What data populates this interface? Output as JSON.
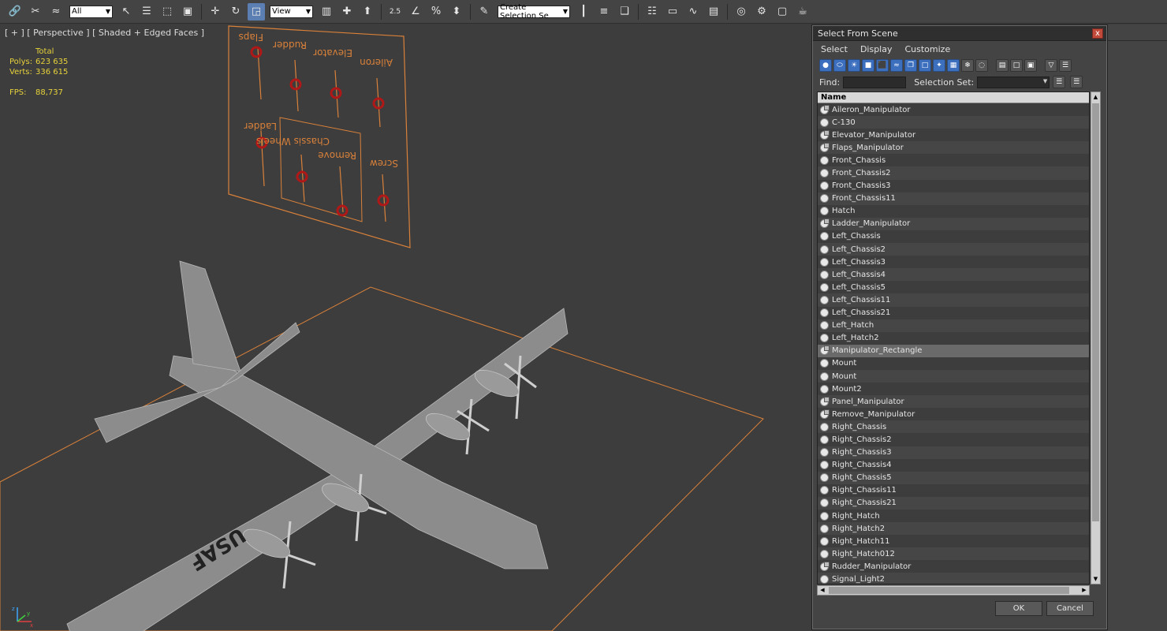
{
  "toolbar": {
    "selection_filter": "All",
    "coordinate_system": "View",
    "snap_angle_label": "2.5",
    "named_selection_placeholder": "Create Selection Se",
    "icons": [
      "link-icon",
      "unlink-icon",
      "bind-spacewarp-icon",
      "select-icon",
      "select-by-name-icon",
      "rect-region-icon",
      "window-crossing-icon",
      "move-icon",
      "rotate-icon",
      "scale-icon",
      "pivot-icon",
      "select-manipulate-icon",
      "snap-icon",
      "angle-snap-icon",
      "percent-snap-icon",
      "spinner-snap-icon",
      "edit-named-selection-icon",
      "mirror-icon",
      "align-icon",
      "layer-icon",
      "scene-explorer-icon",
      "curve-editor-icon",
      "schematic-icon",
      "material-editor-icon",
      "render-setup-icon",
      "rendered-frame-icon",
      "render-icon"
    ]
  },
  "viewport": {
    "label": "[ + ] [ Perspective ] [ Shaded + Edged Faces ]",
    "stats": {
      "header": "Total",
      "polys_label": "Polys:",
      "polys_value": "623 635",
      "verts_label": "Verts:",
      "verts_value": "336 615",
      "fps_label": "FPS:",
      "fps_value": "88,737"
    },
    "panel_labels": [
      "Flaps",
      "Rudder",
      "Elevator",
      "Aileron",
      "Ladder",
      "Chassis Wheels",
      "Remove",
      "Screw"
    ],
    "aircraft_marking": "USAF",
    "axis": {
      "x": "x",
      "y": "y",
      "z": "z"
    }
  },
  "dialog": {
    "title": "Select From Scene",
    "close_label": "x",
    "menu": [
      "Select",
      "Display",
      "Customize"
    ],
    "find_label": "Find:",
    "selection_set_label": "Selection Set:",
    "column_header": "Name",
    "items": [
      {
        "name": "Aileron_Manipulator",
        "helper": true
      },
      {
        "name": "C-130",
        "helper": false
      },
      {
        "name": "Elevator_Manipulator",
        "helper": true
      },
      {
        "name": "Flaps_Manipulator",
        "helper": true
      },
      {
        "name": "Front_Chassis",
        "helper": false
      },
      {
        "name": "Front_Chassis2",
        "helper": false
      },
      {
        "name": "Front_Chassis3",
        "helper": false
      },
      {
        "name": "Front_Chassis11",
        "helper": false
      },
      {
        "name": "Hatch",
        "helper": false
      },
      {
        "name": "Ladder_Manipulator",
        "helper": true
      },
      {
        "name": "Left_Chassis",
        "helper": false
      },
      {
        "name": "Left_Chassis2",
        "helper": false
      },
      {
        "name": "Left_Chassis3",
        "helper": false
      },
      {
        "name": "Left_Chassis4",
        "helper": false
      },
      {
        "name": "Left_Chassis5",
        "helper": false
      },
      {
        "name": "Left_Chassis11",
        "helper": false
      },
      {
        "name": "Left_Chassis21",
        "helper": false
      },
      {
        "name": "Left_Hatch",
        "helper": false
      },
      {
        "name": "Left_Hatch2",
        "helper": false
      },
      {
        "name": "Manipulator_Rectangle",
        "helper": true,
        "selected": true
      },
      {
        "name": "Mount",
        "helper": false
      },
      {
        "name": "Mount",
        "helper": false
      },
      {
        "name": "Mount2",
        "helper": false
      },
      {
        "name": "Panel_Manipulator",
        "helper": true
      },
      {
        "name": "Remove_Manipulator",
        "helper": true
      },
      {
        "name": "Right_Chassis",
        "helper": false
      },
      {
        "name": "Right_Chassis2",
        "helper": false
      },
      {
        "name": "Right_Chassis3",
        "helper": false
      },
      {
        "name": "Right_Chassis4",
        "helper": false
      },
      {
        "name": "Right_Chassis5",
        "helper": false
      },
      {
        "name": "Right_Chassis11",
        "helper": false
      },
      {
        "name": "Right_Chassis21",
        "helper": false
      },
      {
        "name": "Right_Hatch",
        "helper": false
      },
      {
        "name": "Right_Hatch2",
        "helper": false
      },
      {
        "name": "Right_Hatch11",
        "helper": false
      },
      {
        "name": "Right_Hatch012",
        "helper": false
      },
      {
        "name": "Rudder_Manipulator",
        "helper": true
      },
      {
        "name": "Signal_Light2",
        "helper": false
      }
    ],
    "ok_label": "OK",
    "cancel_label": "Cancel"
  },
  "colors": {
    "viewport_bg": "#3d3d3d",
    "stats_text": "#e7d23a",
    "panel_orange": "#d9813a",
    "manipulator_red": "#b01818",
    "mesh_gray": "#9a9a9a",
    "toolbar_active": "#5b7fb3"
  }
}
